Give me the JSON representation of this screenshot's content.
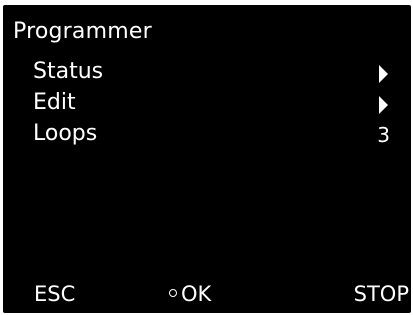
{
  "title": "Programmer",
  "menu": [
    {
      "label": "Status",
      "icon": "chevron-right-icon"
    },
    {
      "label": "Edit",
      "icon": "chevron-right-icon"
    },
    {
      "label": "Loops",
      "value": "3"
    }
  ],
  "softkeys": {
    "esc": "ESC",
    "ok": "OK",
    "stop": "STOP"
  },
  "colors": {
    "background": "#000000",
    "foreground": "#ffffff"
  }
}
